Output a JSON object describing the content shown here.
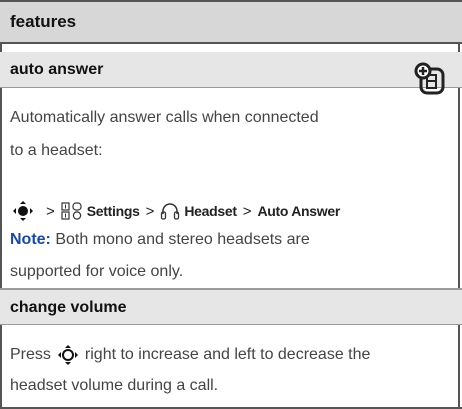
{
  "header": {
    "title": "features"
  },
  "auto_answer": {
    "title": "auto answer",
    "desc_line1": "Automatically answer calls when connected",
    "desc_line2": "to a headset:",
    "path": {
      "sep": ">",
      "settings_label": "Settings",
      "headset_label": "Headset",
      "auto_answer_label": "Auto Answer"
    },
    "note_label": "Note:",
    "note_line1": "Both mono and stereo headsets are",
    "note_line2": "supported for voice only."
  },
  "change_volume": {
    "title": "change volume",
    "line1_a": "Press",
    "line1_b": "right to increase and left to decrease the",
    "line2": "headset volume during a call."
  },
  "icons": {
    "feature": "network-feature-icon",
    "nav_center": "nav-key-center-icon",
    "settings": "settings-icon",
    "headset": "headset-icon",
    "nav_key": "nav-key-icon"
  }
}
